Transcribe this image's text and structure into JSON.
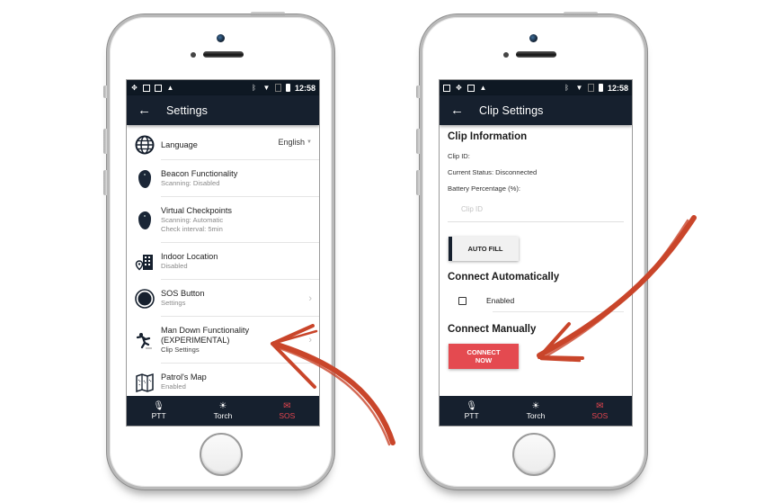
{
  "colors": {
    "app_bar": "#16202e",
    "status_bar": "#0e1823",
    "sos_red": "#e5454f",
    "connect_button": "#e44a50",
    "annotation_arrow": "#c9452a"
  },
  "status_bar": {
    "time": "12:58",
    "left_icons": [
      "sync-icon",
      "image-icon",
      "calendar-icon",
      "warning-icon"
    ],
    "right_icons": [
      "bluetooth-icon",
      "wifi-icon",
      "no-sim-icon",
      "battery-icon"
    ]
  },
  "screen_settings": {
    "title": "Settings",
    "items": [
      {
        "icon": "globe-icon",
        "title": "Language",
        "value": "English"
      },
      {
        "icon": "beacon-icon",
        "title": "Beacon Functionality",
        "subtitle": "Scanning: Disabled"
      },
      {
        "icon": "beacon-icon",
        "title": "Virtual Checkpoints",
        "subtitle": "Scanning: Automatic",
        "subtitle2": "Check interval: 5min"
      },
      {
        "icon": "indoor-location-icon",
        "title": "Indoor Location",
        "subtitle": "Disabled"
      },
      {
        "icon": "sos-button-icon",
        "title": "SOS Button",
        "subtitle": "Settings"
      },
      {
        "icon": "man-down-icon",
        "title": "Man Down Functionality",
        "title2": "(EXPERIMENTAL)",
        "subtitle": "Clip Settings"
      },
      {
        "icon": "map-icon",
        "title": "Patrol's Map",
        "subtitle": "Enabled"
      }
    ]
  },
  "screen_clip": {
    "title": "Clip Settings",
    "clip_info_heading": "Clip Information",
    "clip_id_label": "Clip ID:",
    "status_label": "Current Status: Disconnected",
    "battery_label": "Battery Percentage (%):",
    "clip_id_placeholder": "Clip ID",
    "auto_fill_label": "AUTO FILL",
    "connect_auto_heading": "Connect Automatically",
    "enabled_label": "Enabled",
    "enabled_checked": false,
    "connect_manual_heading": "Connect Manually",
    "connect_now_line1": "CONNECT",
    "connect_now_line2": "NOW"
  },
  "bottom_nav": [
    {
      "icon": "microphone-icon",
      "label": "PTT"
    },
    {
      "icon": "torch-icon",
      "label": "Torch"
    },
    {
      "icon": "sos-envelope-icon",
      "label": "SOS"
    }
  ]
}
